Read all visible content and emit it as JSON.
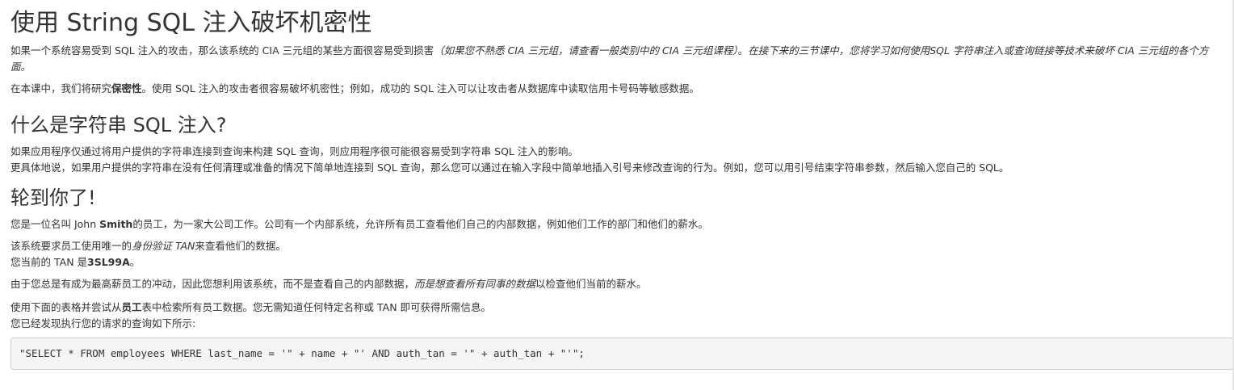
{
  "title": "使用 String SQL 注入破坏机密性",
  "intro": {
    "p1_a": "如果一个系统容易受到 SQL 注入的攻击，那么该系统的 CIA 三元组的某些方面很容易受到损害",
    "p1_b_italic": "（如果您不熟悉 CIA 三元组，请查看一般类别中的 CIA 三元组课程）",
    "p1_c": "。",
    "p1_d_italic": "在接下来的三节课中，您将学习如何使用SQL 字符串注入或查询链接等技术来破坏 CIA 三元组的各个方面。",
    "p2_a": "在本课中，我们将研究",
    "p2_b_bold": "保密性",
    "p2_c": "。使用 SQL 注入的攻击者很容易破坏机密性；例如，成功的 SQL 注入可以让攻击者从数据库中读取信用卡号码等敏感数据。"
  },
  "section_what": {
    "heading": "什么是字符串 SQL 注入?",
    "line1": "如果应用程序仅通过将用户提供的字符串连接到查询来构建 SQL 查询，则应用程序很可能很容易受到字符串 SQL 注入的影响。",
    "line2": "更具体地说，如果用户提供的字符串在没有任何清理或准备的情况下简单地连接到 SQL 查询，那么您可以通过在输入字段中简单地插入引号来修改查询的行为。例如，您可以用引号结束字符串参数，然后输入您自己的 SQL。"
  },
  "section_turn": {
    "heading": "轮到你了!",
    "p1_a": "您是一位名叫 John ",
    "p1_b_bold": "Smith",
    "p1_c": "的员工，为一家大公司工作。公司有一个内部系统，允许所有员工查看他们自己的内部数据，例如他们工作的部门和他们的薪水。",
    "p2_line1_a": "该系统要求员工使用唯一的",
    "p2_line1_b_italic": "身份验证 TAN",
    "p2_line1_c": "来查看他们的数据。",
    "p2_line2_a": "您当前的 TAN 是",
    "p2_line2_b_bold": "3SL99A",
    "p2_line2_c": "。",
    "p3_a": "由于您总是有成为最高薪员工的冲动，因此您想利用该系统，而不是查看自己的内部数据，",
    "p3_b_italic": "而是想查看所有同事的数据",
    "p3_c": "以检查他们当前的薪水。",
    "p4_line1_a": "使用下面的表格并尝试从",
    "p4_line1_b_bold": "员工",
    "p4_line1_c": "表中检索所有员工数据。您无需知道任何特定名称或 TAN 即可获得所需信息。",
    "p4_line2": "您已经发现执行您的请求的查询如下所示:",
    "query": "\"SELECT * FROM employees WHERE last_name = '\" + name + \"' AND auth_tan = '\" + auth_tan + \"'\";"
  }
}
